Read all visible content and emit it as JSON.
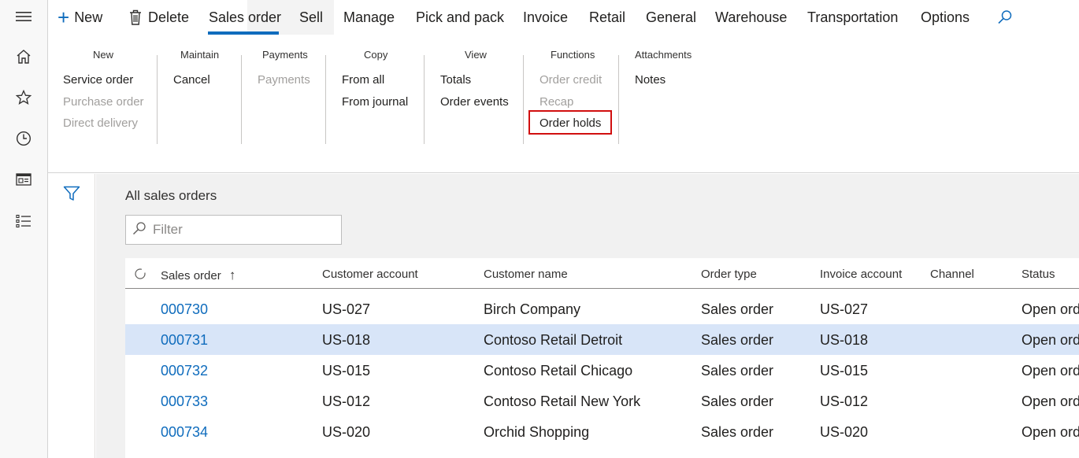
{
  "toolbar": {
    "new_label": "New",
    "delete_label": "Delete",
    "tabs": [
      "Sales order",
      "Sell",
      "Manage",
      "Pick and pack",
      "Invoice",
      "Retail",
      "General",
      "Warehouse",
      "Transportation",
      "Options"
    ],
    "active_tab": "Sales order",
    "search_icon": "search-icon"
  },
  "nav_rail": [
    "hamburger-icon",
    "home-icon",
    "star-icon",
    "clock-icon",
    "workspace-icon",
    "list-icon"
  ],
  "ribbon": {
    "groups": [
      {
        "title": "New",
        "items": [
          {
            "label": "Service order",
            "enabled": true
          },
          {
            "label": "Purchase order",
            "enabled": false
          },
          {
            "label": "Direct delivery",
            "enabled": false
          }
        ]
      },
      {
        "title": "Maintain",
        "items": [
          {
            "label": "Cancel",
            "enabled": true
          }
        ]
      },
      {
        "title": "Payments",
        "items": [
          {
            "label": "Payments",
            "enabled": false
          }
        ]
      },
      {
        "title": "Copy",
        "items": [
          {
            "label": "From all",
            "enabled": true
          },
          {
            "label": "From journal",
            "enabled": true
          }
        ]
      },
      {
        "title": "View",
        "items": [
          {
            "label": "Totals",
            "enabled": true
          },
          {
            "label": "Order events",
            "enabled": true
          }
        ]
      },
      {
        "title": "Functions",
        "items": [
          {
            "label": "Order credit",
            "enabled": false
          },
          {
            "label": "Recap",
            "enabled": false
          },
          {
            "label": "Order holds",
            "enabled": true
          }
        ]
      },
      {
        "title": "Attachments",
        "items": [
          {
            "label": "Notes",
            "enabled": true
          }
        ]
      }
    ],
    "highlighted_item": "Order holds",
    "highlight_color": "#d10f0f"
  },
  "list": {
    "title": "All sales orders",
    "filter_placeholder": "Filter",
    "columns": [
      "Sales order",
      "Customer account",
      "Customer name",
      "Order type",
      "Invoice account",
      "Channel",
      "Status"
    ],
    "sort_column": "Sales order",
    "rows": [
      {
        "order": "000730",
        "account": "US-027",
        "name": "Birch Company",
        "type": "Sales order",
        "invoice": "US-027",
        "channel": "",
        "status": "Open ord"
      },
      {
        "order": "000731",
        "account": "US-018",
        "name": "Contoso Retail Detroit",
        "type": "Sales order",
        "invoice": "US-018",
        "channel": "",
        "status": "Open ord"
      },
      {
        "order": "000732",
        "account": "US-015",
        "name": "Contoso Retail Chicago",
        "type": "Sales order",
        "invoice": "US-015",
        "channel": "",
        "status": "Open ord"
      },
      {
        "order": "000733",
        "account": "US-012",
        "name": "Contoso Retail New York",
        "type": "Sales order",
        "invoice": "US-012",
        "channel": "",
        "status": "Open ord"
      },
      {
        "order": "000734",
        "account": "US-020",
        "name": "Orchid Shopping",
        "type": "Sales order",
        "invoice": "US-020",
        "channel": "",
        "status": "Open ord"
      }
    ],
    "selected_order": "000731"
  },
  "colors": {
    "accent": "#0f6cbd",
    "selected_row": "#d8e5f8",
    "disabled_text": "#a19f9d"
  }
}
